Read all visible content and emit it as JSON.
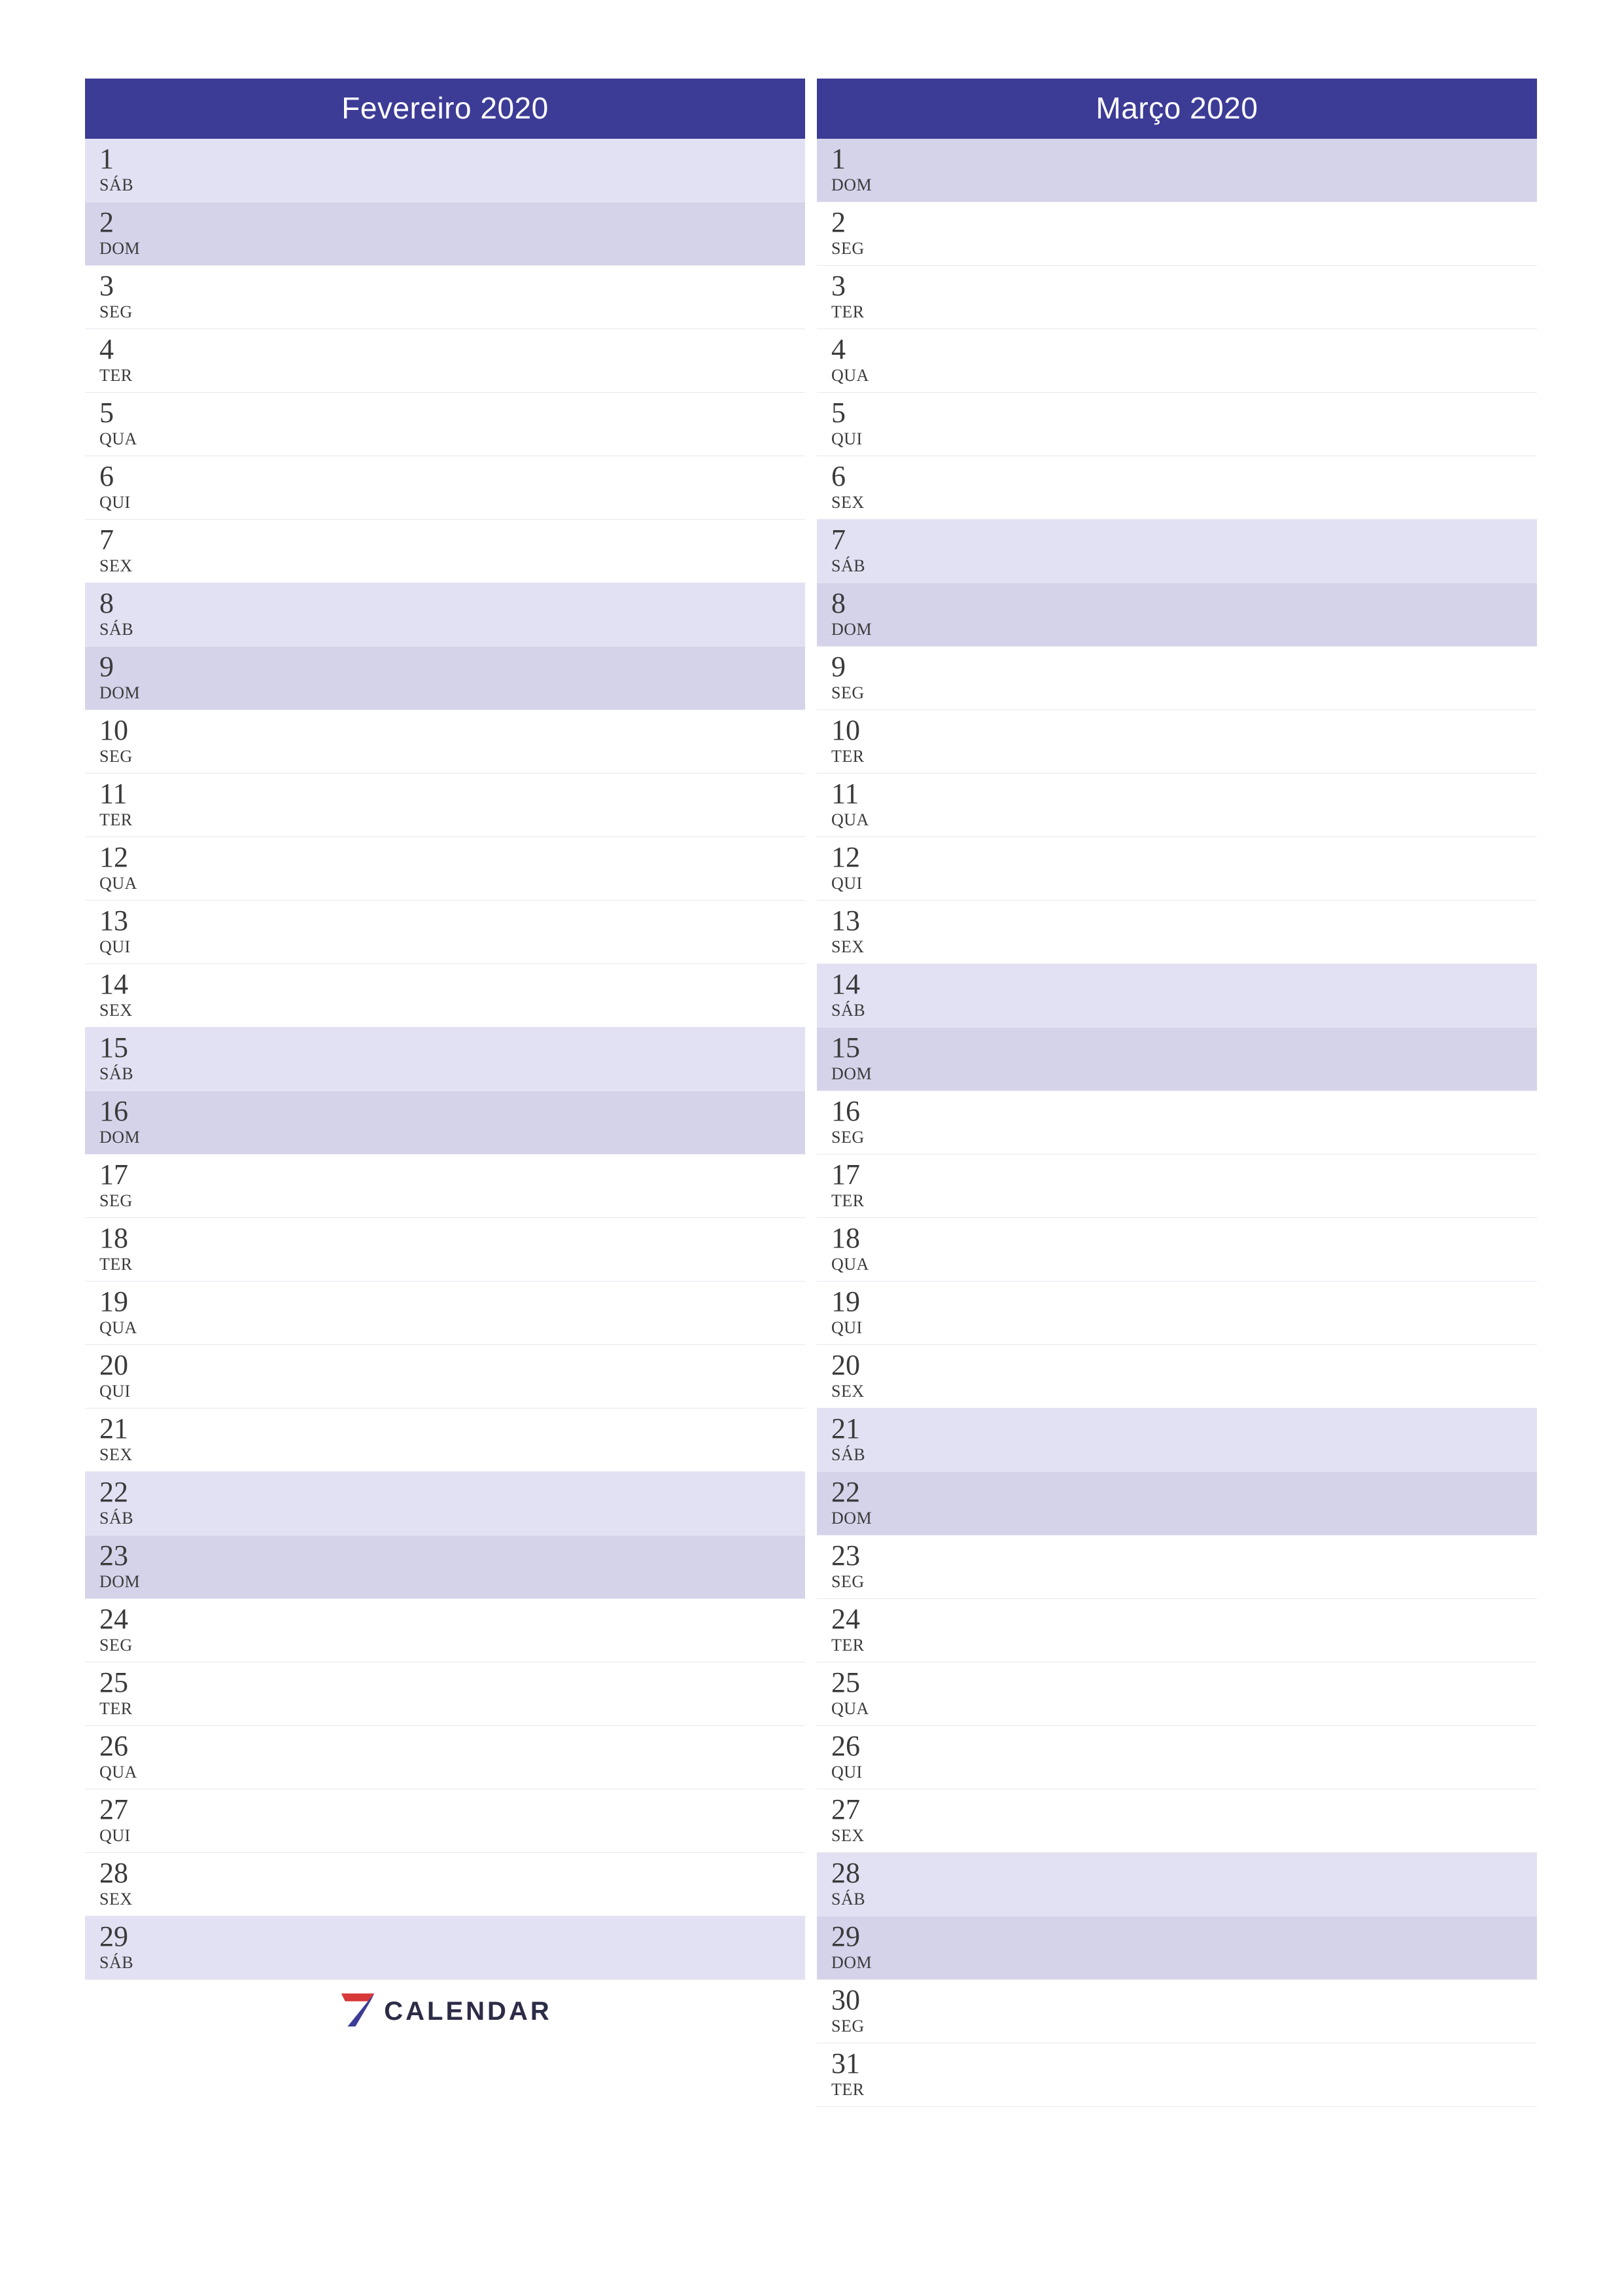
{
  "brand": {
    "text": "CALENDAR"
  },
  "months": [
    {
      "title": "Fevereiro 2020",
      "days": [
        {
          "n": "1",
          "wd": "SÁB",
          "cls": "sat"
        },
        {
          "n": "2",
          "wd": "DOM",
          "cls": "sun"
        },
        {
          "n": "3",
          "wd": "SEG",
          "cls": ""
        },
        {
          "n": "4",
          "wd": "TER",
          "cls": ""
        },
        {
          "n": "5",
          "wd": "QUA",
          "cls": ""
        },
        {
          "n": "6",
          "wd": "QUI",
          "cls": ""
        },
        {
          "n": "7",
          "wd": "SEX",
          "cls": ""
        },
        {
          "n": "8",
          "wd": "SÁB",
          "cls": "sat"
        },
        {
          "n": "9",
          "wd": "DOM",
          "cls": "sun"
        },
        {
          "n": "10",
          "wd": "SEG",
          "cls": ""
        },
        {
          "n": "11",
          "wd": "TER",
          "cls": ""
        },
        {
          "n": "12",
          "wd": "QUA",
          "cls": ""
        },
        {
          "n": "13",
          "wd": "QUI",
          "cls": ""
        },
        {
          "n": "14",
          "wd": "SEX",
          "cls": ""
        },
        {
          "n": "15",
          "wd": "SÁB",
          "cls": "sat"
        },
        {
          "n": "16",
          "wd": "DOM",
          "cls": "sun"
        },
        {
          "n": "17",
          "wd": "SEG",
          "cls": ""
        },
        {
          "n": "18",
          "wd": "TER",
          "cls": ""
        },
        {
          "n": "19",
          "wd": "QUA",
          "cls": ""
        },
        {
          "n": "20",
          "wd": "QUI",
          "cls": ""
        },
        {
          "n": "21",
          "wd": "SEX",
          "cls": ""
        },
        {
          "n": "22",
          "wd": "SÁB",
          "cls": "sat"
        },
        {
          "n": "23",
          "wd": "DOM",
          "cls": "sun"
        },
        {
          "n": "24",
          "wd": "SEG",
          "cls": ""
        },
        {
          "n": "25",
          "wd": "TER",
          "cls": ""
        },
        {
          "n": "26",
          "wd": "QUA",
          "cls": ""
        },
        {
          "n": "27",
          "wd": "QUI",
          "cls": ""
        },
        {
          "n": "28",
          "wd": "SEX",
          "cls": ""
        },
        {
          "n": "29",
          "wd": "SÁB",
          "cls": "sat"
        }
      ],
      "logoAfter": true
    },
    {
      "title": "Março 2020",
      "days": [
        {
          "n": "1",
          "wd": "DOM",
          "cls": "sun"
        },
        {
          "n": "2",
          "wd": "SEG",
          "cls": ""
        },
        {
          "n": "3",
          "wd": "TER",
          "cls": ""
        },
        {
          "n": "4",
          "wd": "QUA",
          "cls": ""
        },
        {
          "n": "5",
          "wd": "QUI",
          "cls": ""
        },
        {
          "n": "6",
          "wd": "SEX",
          "cls": ""
        },
        {
          "n": "7",
          "wd": "SÁB",
          "cls": "sat"
        },
        {
          "n": "8",
          "wd": "DOM",
          "cls": "sun"
        },
        {
          "n": "9",
          "wd": "SEG",
          "cls": ""
        },
        {
          "n": "10",
          "wd": "TER",
          "cls": ""
        },
        {
          "n": "11",
          "wd": "QUA",
          "cls": ""
        },
        {
          "n": "12",
          "wd": "QUI",
          "cls": ""
        },
        {
          "n": "13",
          "wd": "SEX",
          "cls": ""
        },
        {
          "n": "14",
          "wd": "SÁB",
          "cls": "sat"
        },
        {
          "n": "15",
          "wd": "DOM",
          "cls": "sun"
        },
        {
          "n": "16",
          "wd": "SEG",
          "cls": ""
        },
        {
          "n": "17",
          "wd": "TER",
          "cls": ""
        },
        {
          "n": "18",
          "wd": "QUA",
          "cls": ""
        },
        {
          "n": "19",
          "wd": "QUI",
          "cls": ""
        },
        {
          "n": "20",
          "wd": "SEX",
          "cls": ""
        },
        {
          "n": "21",
          "wd": "SÁB",
          "cls": "sat"
        },
        {
          "n": "22",
          "wd": "DOM",
          "cls": "sun"
        },
        {
          "n": "23",
          "wd": "SEG",
          "cls": ""
        },
        {
          "n": "24",
          "wd": "TER",
          "cls": ""
        },
        {
          "n": "25",
          "wd": "QUA",
          "cls": ""
        },
        {
          "n": "26",
          "wd": "QUI",
          "cls": ""
        },
        {
          "n": "27",
          "wd": "SEX",
          "cls": ""
        },
        {
          "n": "28",
          "wd": "SÁB",
          "cls": "sat"
        },
        {
          "n": "29",
          "wd": "DOM",
          "cls": "sun"
        },
        {
          "n": "30",
          "wd": "SEG",
          "cls": ""
        },
        {
          "n": "31",
          "wd": "TER",
          "cls": ""
        }
      ],
      "logoAfter": false
    }
  ]
}
